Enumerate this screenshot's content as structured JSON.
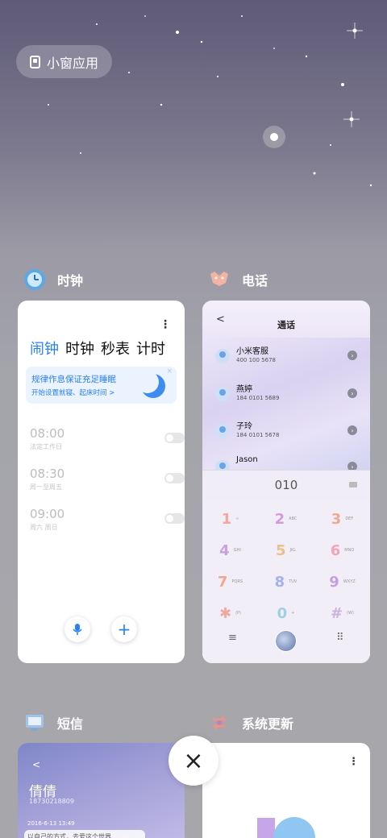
{
  "chip": {
    "label": "小窗应用",
    "icon": "mini-window-icon"
  },
  "apps": {
    "clock": {
      "name": "时钟",
      "icon": "clock-icon"
    },
    "phone": {
      "name": "电话",
      "icon": "phone-icon"
    },
    "sms": {
      "name": "短信",
      "icon": "sms-icon"
    },
    "update": {
      "name": "系统更新",
      "icon": "system-update-icon"
    }
  },
  "clock_card": {
    "more": "⋮",
    "tabs": [
      "闹钟",
      "时钟",
      "秒表",
      "计时"
    ],
    "banner": {
      "title": "规律作息保证充足睡眠",
      "subtitle": "开始设置就寝、起床时间 >",
      "close": "×"
    },
    "alarms": [
      {
        "time": "08:00",
        "repeat": "法定工作日",
        "on": false
      },
      {
        "time": "08:30",
        "repeat": "周一至周五",
        "on": false
      },
      {
        "time": "09:00",
        "repeat": "周六 周日",
        "on": false
      }
    ],
    "fab_mic": "mic-icon",
    "fab_add": "+"
  },
  "phone_card": {
    "back": "<",
    "title": "通话",
    "contacts": [
      {
        "name": "小米客服",
        "number": "400 100 5678"
      },
      {
        "name": "燕婷",
        "number": "184 0101 5689"
      },
      {
        "name": "子玲",
        "number": "184 0101 5678"
      },
      {
        "name": "Jason",
        "number": ""
      }
    ],
    "dial_number": "010",
    "keys": [
      {
        "digit": "1",
        "letters": "∞",
        "color": "#f0a8a0"
      },
      {
        "digit": "2",
        "letters": "ABC",
        "color": "#d59ad8"
      },
      {
        "digit": "3",
        "letters": "DEF",
        "color": "#f0a890"
      },
      {
        "digit": "4",
        "letters": "GHI",
        "color": "#c9a2dd"
      },
      {
        "digit": "5",
        "letters": "JKL",
        "color": "#e8c28c"
      },
      {
        "digit": "6",
        "letters": "MNO",
        "color": "#f0a6b6"
      },
      {
        "digit": "7",
        "letters": "PQRS",
        "color": "#f0a890"
      },
      {
        "digit": "8",
        "letters": "TUV",
        "color": "#a6b2e6"
      },
      {
        "digit": "9",
        "letters": "WXYZ",
        "color": "#c6a0dc"
      },
      {
        "digit": "✱",
        "letters": "(P)",
        "color": "#f0a8a0"
      },
      {
        "digit": "0",
        "letters": "+",
        "color": "#9fd0e0"
      },
      {
        "digit": "#",
        "letters": "(W)",
        "color": "#c9b4dd"
      }
    ],
    "menu": "≡",
    "keypad_icon": "⠿"
  },
  "sms_card": {
    "back": "<",
    "name": "倩倩",
    "number": "18730218809",
    "date": "2016-6-13 13:49",
    "preview": "以自己的方式，去爱这个世界"
  },
  "update_card": {
    "more": "⋮"
  },
  "close_button": "×"
}
